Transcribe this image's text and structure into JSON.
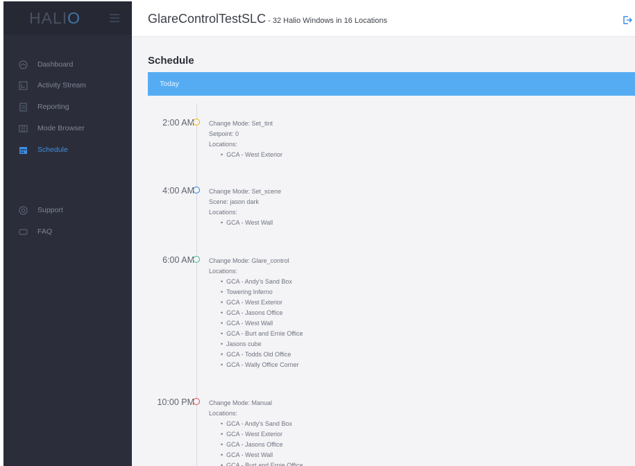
{
  "brand": {
    "logo_text": "HALIO"
  },
  "sidebar": {
    "items": [
      {
        "label": "Dashboard",
        "icon": "dashboard-icon"
      },
      {
        "label": "Activity Stream",
        "icon": "activity-icon"
      },
      {
        "label": "Reporting",
        "icon": "report-icon"
      },
      {
        "label": "Mode Browser",
        "icon": "mode-browser-icon"
      },
      {
        "label": "Schedule",
        "icon": "calendar-icon",
        "active": true
      },
      {
        "label": "Support",
        "icon": "support-icon"
      },
      {
        "label": "FAQ",
        "icon": "faq-icon"
      }
    ]
  },
  "header": {
    "title": "GlareControlTestSLC",
    "subtitle": " - 32 Halio Windows in 16 Locations"
  },
  "main": {
    "section_title": "Schedule",
    "day_label": "Today",
    "events": [
      {
        "time": "2:00 AM",
        "dot_color": "#f0b300",
        "mode": "Change Mode: Set_tint",
        "extra": "Setpoint: 0",
        "locations_label": "Locations:",
        "locations": [
          "GCA - West Exterior"
        ]
      },
      {
        "time": "4:00 AM",
        "dot_color": "#2f7fd1",
        "mode": "Change Mode: Set_scene",
        "extra": "Scene: jason dark",
        "locations_label": "Locations:",
        "locations": [
          "GCA - West Wall"
        ]
      },
      {
        "time": "6:00 AM",
        "dot_color": "#3cb88c",
        "mode": "Change Mode: Glare_control",
        "extra": "",
        "locations_label": "Locations:",
        "locations": [
          "GCA - Andy's Sand Box",
          "Towering Inferno",
          "GCA - West Exterior",
          "GCA - Jasons Office",
          "GCA - West Wall",
          "GCA - Burt and Ernie Office",
          "Jasons cube",
          "GCA - Todds Old Office",
          "GCA - Wally Office Corner"
        ]
      },
      {
        "time": "10:00 PM",
        "dot_color": "#e0474c",
        "mode": "Change Mode: Manual",
        "extra": "",
        "locations_label": "Locations:",
        "locations": [
          "GCA - Andy's Sand Box",
          "GCA - West Exterior",
          "GCA - Jasons Office",
          "GCA - West Wall",
          "GCA - Burt and Ernie Office"
        ]
      }
    ]
  }
}
